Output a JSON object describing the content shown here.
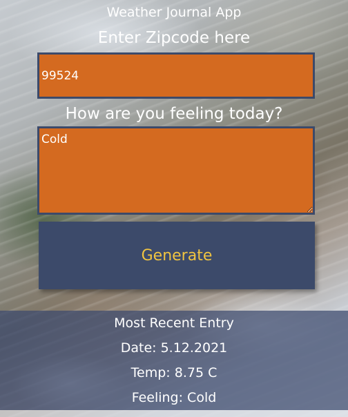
{
  "app": {
    "title": "Weather Journal App"
  },
  "form": {
    "zip_label": "Enter Zipcode here",
    "zip_value": "99524",
    "feeling_label": "How are you feeling today?",
    "feeling_value": "Cold",
    "generate_label": "Generate"
  },
  "recent_entry": {
    "heading": "Most Recent Entry",
    "date": "Date: 5.12.2021",
    "temp": "Temp: 8.75 C",
    "feeling": "Feeling: Cold"
  },
  "colors": {
    "input_background": "#d46a20",
    "input_border": "#3c4a6a",
    "button_background": "#3c4a6a",
    "button_text": "#f1c440",
    "panel_background": "#3c4a6e"
  },
  "background": {
    "description_icon": "satellite-map-image"
  }
}
